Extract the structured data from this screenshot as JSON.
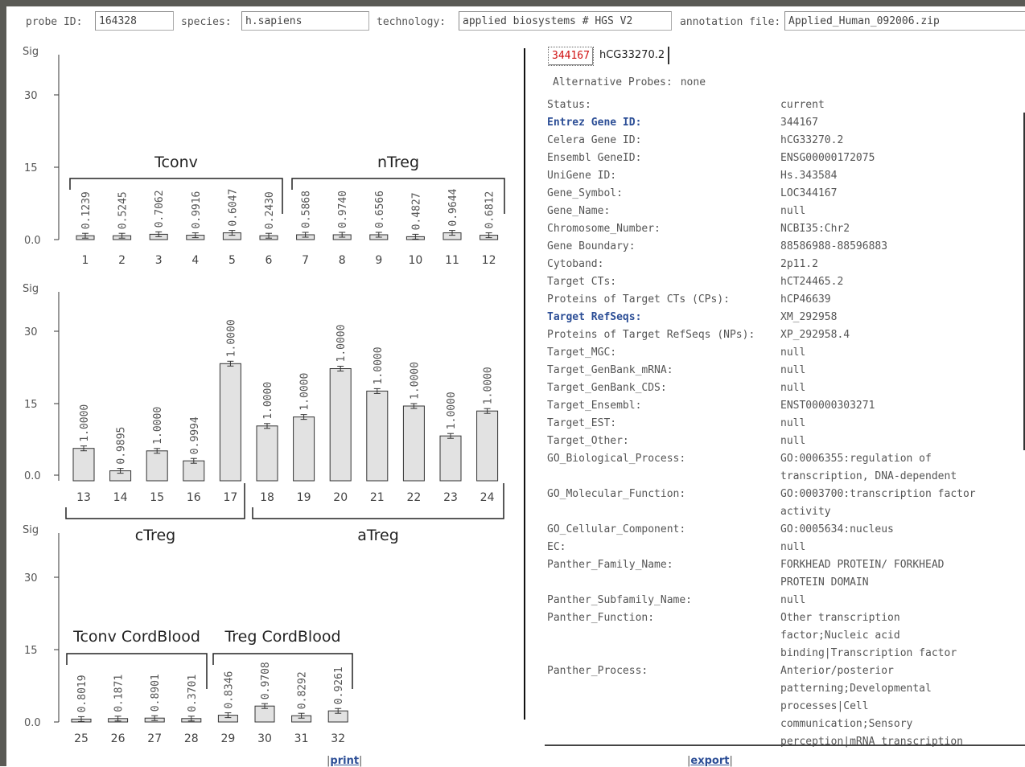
{
  "header": {
    "probe_label": "probe ID:",
    "probe_value": "164328",
    "species_label": "species:",
    "species_value": "h.sapiens",
    "technology_label": "technology:",
    "technology_value": "applied biosystems # HGS V2",
    "annotation_label": "annotation file:",
    "annotation_value": "Applied_Human_092006.zip"
  },
  "chart_data": [
    {
      "type": "bar",
      "ylabel": "Sig",
      "yticks": [
        "30",
        "15",
        "0.0"
      ],
      "ylim": [
        0,
        35
      ],
      "categories": [
        "1",
        "2",
        "3",
        "4",
        "5",
        "6",
        "7",
        "8",
        "9",
        "10",
        "11",
        "12"
      ],
      "values": [
        0.8,
        0.8,
        1.1,
        0.9,
        1.4,
        0.8,
        1.0,
        1.0,
        1.0,
        0.6,
        1.4,
        0.9
      ],
      "value_labels": [
        "0.1239",
        "0.5245",
        "0.7062",
        "0.9916",
        "0.6047",
        "0.2430",
        "0.5868",
        "0.9740",
        "0.6566",
        "0.4827",
        "0.9644",
        "0.6812"
      ],
      "groups": [
        {
          "label": "Tconv",
          "start": 0,
          "end": 5,
          "position": "top"
        },
        {
          "label": "nTreg",
          "start": 6,
          "end": 11,
          "position": "top"
        }
      ]
    },
    {
      "type": "bar",
      "ylabel": "Sig",
      "yticks": [
        "30",
        "15",
        "0.0"
      ],
      "ylim": [
        0,
        35
      ],
      "categories": [
        "13",
        "14",
        "15",
        "16",
        "17",
        "18",
        "19",
        "20",
        "21",
        "22",
        "23",
        "24"
      ],
      "values": [
        6.5,
        2.0,
        6.0,
        4.0,
        23.5,
        11.0,
        12.8,
        22.5,
        18.0,
        15.0,
        9.0,
        14.0
      ],
      "value_labels": [
        "1.0000",
        "0.9895",
        "1.0000",
        "0.9994",
        "1.0000",
        "1.0000",
        "1.0000",
        "1.0000",
        "1.0000",
        "1.0000",
        "1.0000",
        "1.0000"
      ],
      "groups": [
        {
          "label": "cTreg",
          "start": 0,
          "end": 4,
          "position": "bottom"
        },
        {
          "label": "aTreg",
          "start": 5,
          "end": 11,
          "position": "bottom"
        }
      ]
    },
    {
      "type": "bar",
      "ylabel": "Sig",
      "yticks": [
        "30",
        "15",
        "0.0"
      ],
      "ylim": [
        0,
        35
      ],
      "categories": [
        "25",
        "26",
        "27",
        "28",
        "29",
        "30",
        "31",
        "32"
      ],
      "values": [
        0.6,
        0.7,
        0.8,
        0.7,
        1.4,
        3.3,
        1.3,
        2.3
      ],
      "value_labels": [
        "0.8019",
        "0.1871",
        "0.8901",
        "0.3701",
        "0.8346",
        "0.9708",
        "0.8292",
        "0.9261"
      ],
      "groups": [
        {
          "label": "Tconv CordBlood",
          "start": 0,
          "end": 3,
          "position": "top"
        },
        {
          "label": "Treg CordBlood",
          "start": 4,
          "end": 7,
          "position": "top"
        }
      ]
    }
  ],
  "links": {
    "print": "print",
    "export": "export"
  },
  "tabs": [
    "344167",
    "hCG33270.2"
  ],
  "alternative": {
    "label": "Alternative Probes:",
    "value": "none"
  },
  "attributes": [
    {
      "key": "Status:",
      "value": "current",
      "link": false
    },
    {
      "key": "Entrez Gene ID:",
      "value": "344167",
      "link": true
    },
    {
      "key": "Celera Gene ID:",
      "value": "hCG33270.2",
      "link": false
    },
    {
      "key": "Ensembl GeneID:",
      "value": "ENSG00000172075",
      "link": false
    },
    {
      "key": "UniGene ID:",
      "value": "Hs.343584",
      "link": false
    },
    {
      "key": "Gene_Symbol:",
      "value": "LOC344167",
      "link": false
    },
    {
      "key": "Gene_Name:",
      "value": "null",
      "link": false
    },
    {
      "key": "Chromosome_Number:",
      "value": "NCBI35:Chr2",
      "link": false
    },
    {
      "key": "Gene Boundary:",
      "value": "88586988-88596883",
      "link": false
    },
    {
      "key": "Cytoband:",
      "value": "2p11.2",
      "link": false
    },
    {
      "key": "Target CTs:",
      "value": "hCT24465.2",
      "link": false
    },
    {
      "key": "Proteins of Target CTs (CPs):",
      "value": "hCP46639",
      "link": false
    },
    {
      "key": "Target RefSeqs:",
      "value": "XM_292958",
      "link": true
    },
    {
      "key": "Proteins of Target RefSeqs (NPs):",
      "value": "XP_292958.4",
      "link": false
    },
    {
      "key": "Target_MGC:",
      "value": "null",
      "link": false
    },
    {
      "key": "Target_GenBank_mRNA:",
      "value": "null",
      "link": false
    },
    {
      "key": "Target_GenBank_CDS:",
      "value": "null",
      "link": false
    },
    {
      "key": "Target_Ensembl:",
      "value": "ENST00000303271",
      "link": false
    },
    {
      "key": "Target_EST:",
      "value": "null",
      "link": false
    },
    {
      "key": "Target_Other:",
      "value": "null",
      "link": false
    },
    {
      "key": "GO_Biological_Process:",
      "value": "GO:0006355:regulation of transcription, DNA-dependent",
      "link": false
    },
    {
      "key": "GO_Molecular_Function:",
      "value": "GO:0003700:transcription factor activity",
      "link": false
    },
    {
      "key": "GO_Cellular_Component:",
      "value": "GO:0005634:nucleus",
      "link": false
    },
    {
      "key": "EC:",
      "value": "null",
      "link": false
    },
    {
      "key": "Panther_Family_Name:",
      "value": "FORKHEAD PROTEIN/ FORKHEAD PROTEIN DOMAIN",
      "link": false
    },
    {
      "key": "Panther_Subfamily_Name:",
      "value": "null",
      "link": false
    },
    {
      "key": "Panther_Function:",
      "value": "Other transcription factor;Nucleic acid binding|Transcription factor",
      "link": false
    },
    {
      "key": "Panther_Process:",
      "value": "Anterior/posterior patterning;Developmental processes|Cell communication;Sensory perception|mRNA transcription",
      "link": false
    }
  ]
}
